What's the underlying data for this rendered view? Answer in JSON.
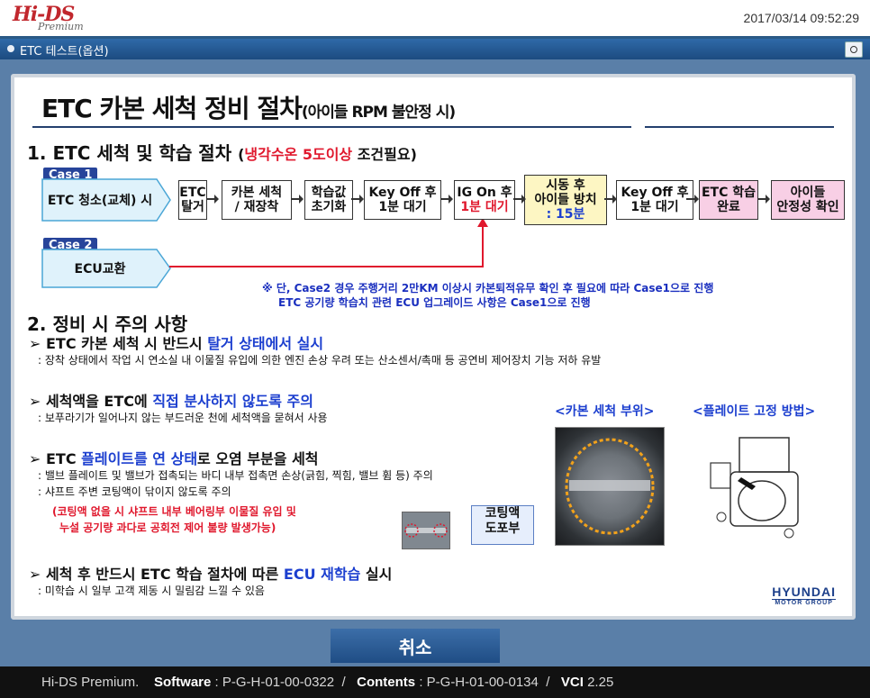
{
  "header": {
    "logo_main": "Hi-DS",
    "logo_sub": "Premium",
    "datetime": "2017/03/14 09:52:29"
  },
  "window": {
    "title": "ETC 테스트(옵션)"
  },
  "doc": {
    "title_main": "ETC 카본 세척 정비 절차",
    "title_sub": "(아이들 RPM 불안정 시)",
    "sec1_prefix": "1. ETC 세척 및 학습 절차 ",
    "sec1_open": "(",
    "sec1_red": "냉각수온 5도이상",
    "sec1_close": " 조건필요)",
    "case1_tag": "Case 1",
    "case1_label": "ETC 청소(교체) 시",
    "case2_tag": "Case 2",
    "case2_label": "ECU교환",
    "steps": [
      {
        "l1": "ETC",
        "l2": "탈거"
      },
      {
        "l1": "카본 세척",
        "l2": "/ 재장착"
      },
      {
        "l1": "학습값",
        "l2": "초기화"
      },
      {
        "l1": "Key Off 후",
        "l2": "1분 대기"
      },
      {
        "l1": "IG On 후",
        "l2": "1분 대기"
      },
      {
        "l1": "시동 후",
        "l2": "아이들 방치",
        "l3": ": 15분"
      },
      {
        "l1": "Key Off 후",
        "l2": "1분 대기"
      },
      {
        "l1": "ETC 학습",
        "l2": "완료"
      },
      {
        "l1": "아이들",
        "l2": "안정성 확인"
      }
    ],
    "note1": "※ 단, Case2 경우 주행거리 2만KM 이상시 카본퇴적유무 확인 후 필요에 따라 Case1으로 진행",
    "note2": "ETC 공기량 학습치 관련 ECU 업그레이드 사항은 Case1으로 진행",
    "sec2": "2. 정비 시 주의 사항",
    "items": [
      {
        "pre": "➢ ETC 카본 세척 시 반드시 ",
        "blue": "탈거 상태에서 실시",
        "post": "",
        "desc": ": 장착 상태에서 작업 시 연소실 내 이물질 유입에 의한 엔진 손상 우려 또는 산소센서/촉매 등 공연비 제어장치 기능 저하 유발"
      },
      {
        "pre": "➢ 세척액을 ETC에 ",
        "blue": "직접 분사하지 않도록 주의",
        "post": "",
        "desc": ": 보푸라기가 일어나지 않는 부드러운 천에 세척액을 묻혀서 사용"
      },
      {
        "pre": "➢ ETC ",
        "blue": "플레이트를 연 상태",
        "post": "로 오염 부분을 세척",
        "desc1": ": 밸브 플레이트 및 밸브가 접촉되는 바디 내부 접촉면 손상(긁힘, 찍힘, 밸브 휨 등) 주의",
        "desc2": ": 샤프트 주변 코팅액이 닦이지 않도록 주의",
        "red1": "(코팅액 없을 시 샤프트 내부 베어링부 이물질 유입 및",
        "red2": "누설 공기량 과다로 공회전 제어 불량 발생가능)"
      },
      {
        "pre": "➢ 세척 후 반드시 ETC 학습 절차에 따른 ",
        "blue": "ECU 재학습",
        "post": " 실시",
        "desc": ": 미학습 시 일부 고객 제동 시 밀림감 느낄 수 있음"
      }
    ],
    "img_label_left": "<카본 세척 부위>",
    "img_label_right": "<플레이트 고정 방법>",
    "coating_l1": "코팅액",
    "coating_l2": "도포부",
    "brand_main": "HYUNDAI",
    "brand_sub": "MOTOR GROUP"
  },
  "actions": {
    "cancel_label": "취소"
  },
  "footer": {
    "product": "Hi-DS Premium.",
    "sw_label": "Software",
    "sw_value": ": P-G-H-01-00-0322",
    "sep1": "/",
    "contents_label": "Contents",
    "contents_value": ": P-G-H-01-00-0134",
    "sep2": "/",
    "vci_label": "VCI",
    "vci_value": "2.25"
  }
}
